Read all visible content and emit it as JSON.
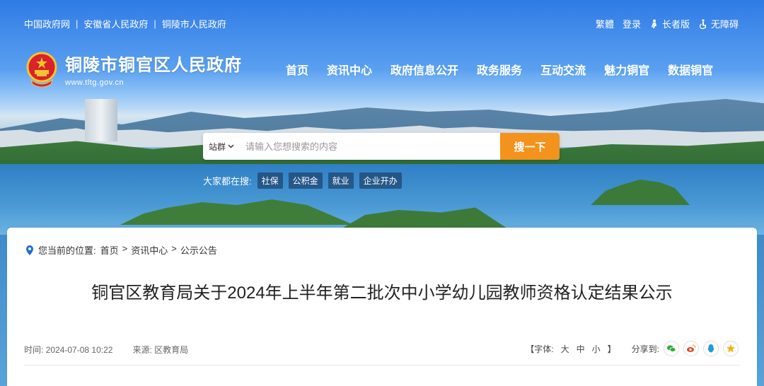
{
  "topbar": {
    "links": [
      "中国政府网",
      "安徽省人民政府",
      "铜陵市人民政府"
    ],
    "separator": "|"
  },
  "toolbar": {
    "traditional": "繁體",
    "login": "登录",
    "elder": "长者版",
    "accessible": "无障碍"
  },
  "header": {
    "title": "铜陵市铜官区人民政府",
    "url": "www.tltg.gov.cn"
  },
  "nav": {
    "items": [
      "首页",
      "资讯中心",
      "政府信息公开",
      "政务服务",
      "互动交流",
      "魅力铜官",
      "数据铜官"
    ]
  },
  "search": {
    "scope": "站群",
    "placeholder": "请输入您想搜索的内容",
    "button": "搜一下"
  },
  "hot_search": {
    "label": "大家都在搜:",
    "tags": [
      "社保",
      "公积金",
      "就业",
      "企业开办"
    ]
  },
  "breadcrumb": {
    "label": "您当前的位置:",
    "items": [
      "首页",
      "资讯中心",
      "公示公告"
    ],
    "separator": ">"
  },
  "article": {
    "title": "铜官区教育局关于2024年上半年第二批次中小学幼儿园教师资格认定结果公示",
    "time_label": "时间:",
    "time": "2024-07-08 10:22",
    "source_label": "来源:",
    "source": "区教育局"
  },
  "font_size": {
    "label": "【字体:",
    "large": "大",
    "medium": "中",
    "small": "小",
    "close": "】"
  },
  "share": {
    "label": "分享到:"
  },
  "colors": {
    "accent_orange": "#f3921d",
    "brand_blue": "#2f7be6",
    "wechat": "#2bae3f",
    "weibo": "#e6492a",
    "qq": "#1f9bdf",
    "qzone": "#f4b20e"
  }
}
